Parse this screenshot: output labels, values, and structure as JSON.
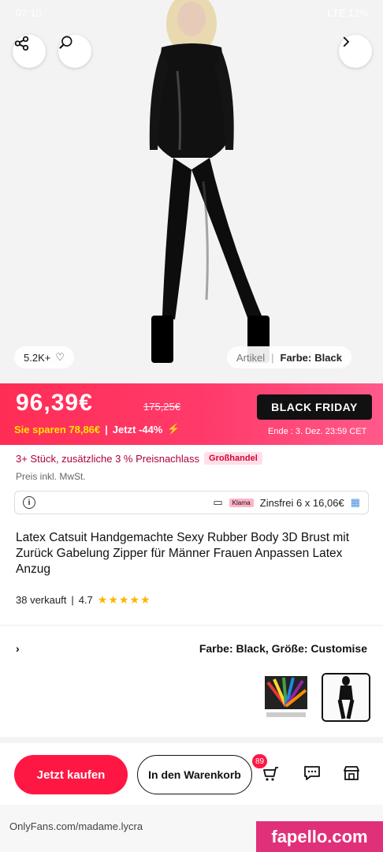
{
  "status_bar": {
    "time": "07:10",
    "signal": "LTE 12%"
  },
  "hero": {
    "share_icon": "share-nodes-icon",
    "search_icon": "search-icon",
    "back_icon": "chevron-right-icon",
    "likes": "5.2K+",
    "color_label": "Farbe:",
    "color_value": "Black",
    "article_label": "Artikel"
  },
  "black_friday": {
    "price": "96,39€",
    "old_price": "175,25€",
    "discount": "Jetzt -44%",
    "savings": "Sie sparen 78,86€",
    "logo": "BLACK FRIDAY",
    "ends": "Ende : 3. Dez. 23:59 CET"
  },
  "wholesale": {
    "badge": "Großhandel",
    "text": "3+ Stück, zusätzliche 3 % Preisnachlass"
  },
  "tax_note": "Preis inkl. MwSt.",
  "installment": {
    "text": "Zinsfrei 6 x 16,06€",
    "provider": "Klarna"
  },
  "product": {
    "title": "Latex Catsuit Handgemachte Sexy Rubber Body 3D Brust mit Zurück Gabelung Zipper für Männer Frauen Anpassen Latex Anzug",
    "rating": "4.7",
    "sold": "38 verkauft"
  },
  "variant": {
    "label": "Farbe: Black, Größe: Customise",
    "arrow_icon": "chevron-right-icon"
  },
  "actions": {
    "buy_now": "Jetzt kaufen",
    "add_to_cart": "In den Warenkorb",
    "cart_count": "89",
    "cart_icon": "cart-icon",
    "chat_icon": "chat-icon",
    "store_icon": "store-icon"
  },
  "browser": {
    "url": "OnlyFans.com/madame.lycra",
    "watermark": "fapello.com"
  },
  "colors": {
    "accent": "#ff1744",
    "banner": "#ff2d55",
    "savings": "#ffe500"
  }
}
